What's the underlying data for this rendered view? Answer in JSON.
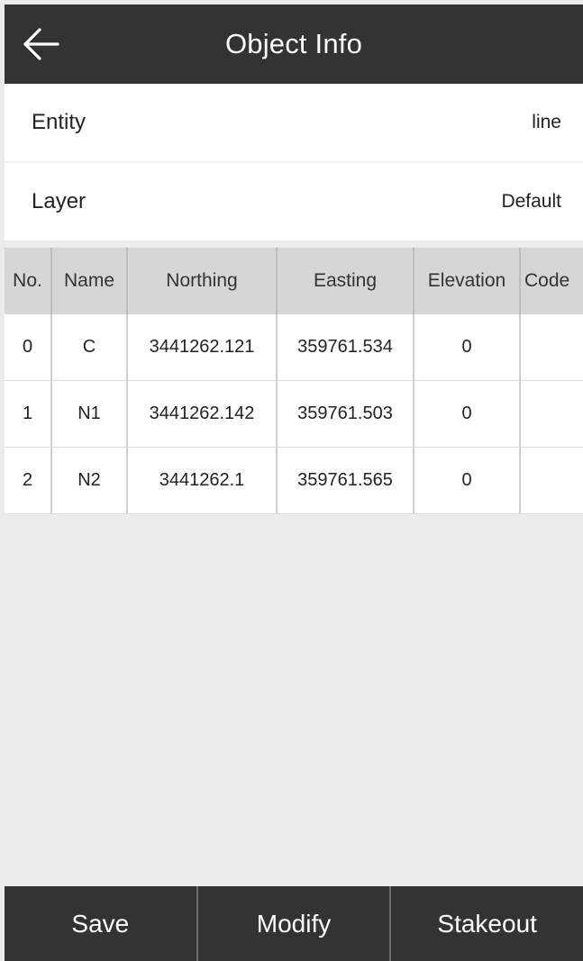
{
  "header": {
    "title": "Object Info"
  },
  "info": {
    "entity": {
      "label": "Entity",
      "value": "line"
    },
    "layer": {
      "label": "Layer",
      "value": "Default"
    }
  },
  "table": {
    "headers": [
      "No.",
      "Name",
      "Northing",
      "Easting",
      "Elevation",
      "Code"
    ],
    "rows": [
      [
        "0",
        "C",
        "3441262.121",
        "359761.534",
        "0",
        ""
      ],
      [
        "1",
        "N1",
        "3441262.142",
        "359761.503",
        "0",
        ""
      ],
      [
        "2",
        "N2",
        "3441262.1",
        "359761.565",
        "0",
        ""
      ]
    ]
  },
  "actions": {
    "save": "Save",
    "modify": "Modify",
    "stakeout": "Stakeout"
  }
}
